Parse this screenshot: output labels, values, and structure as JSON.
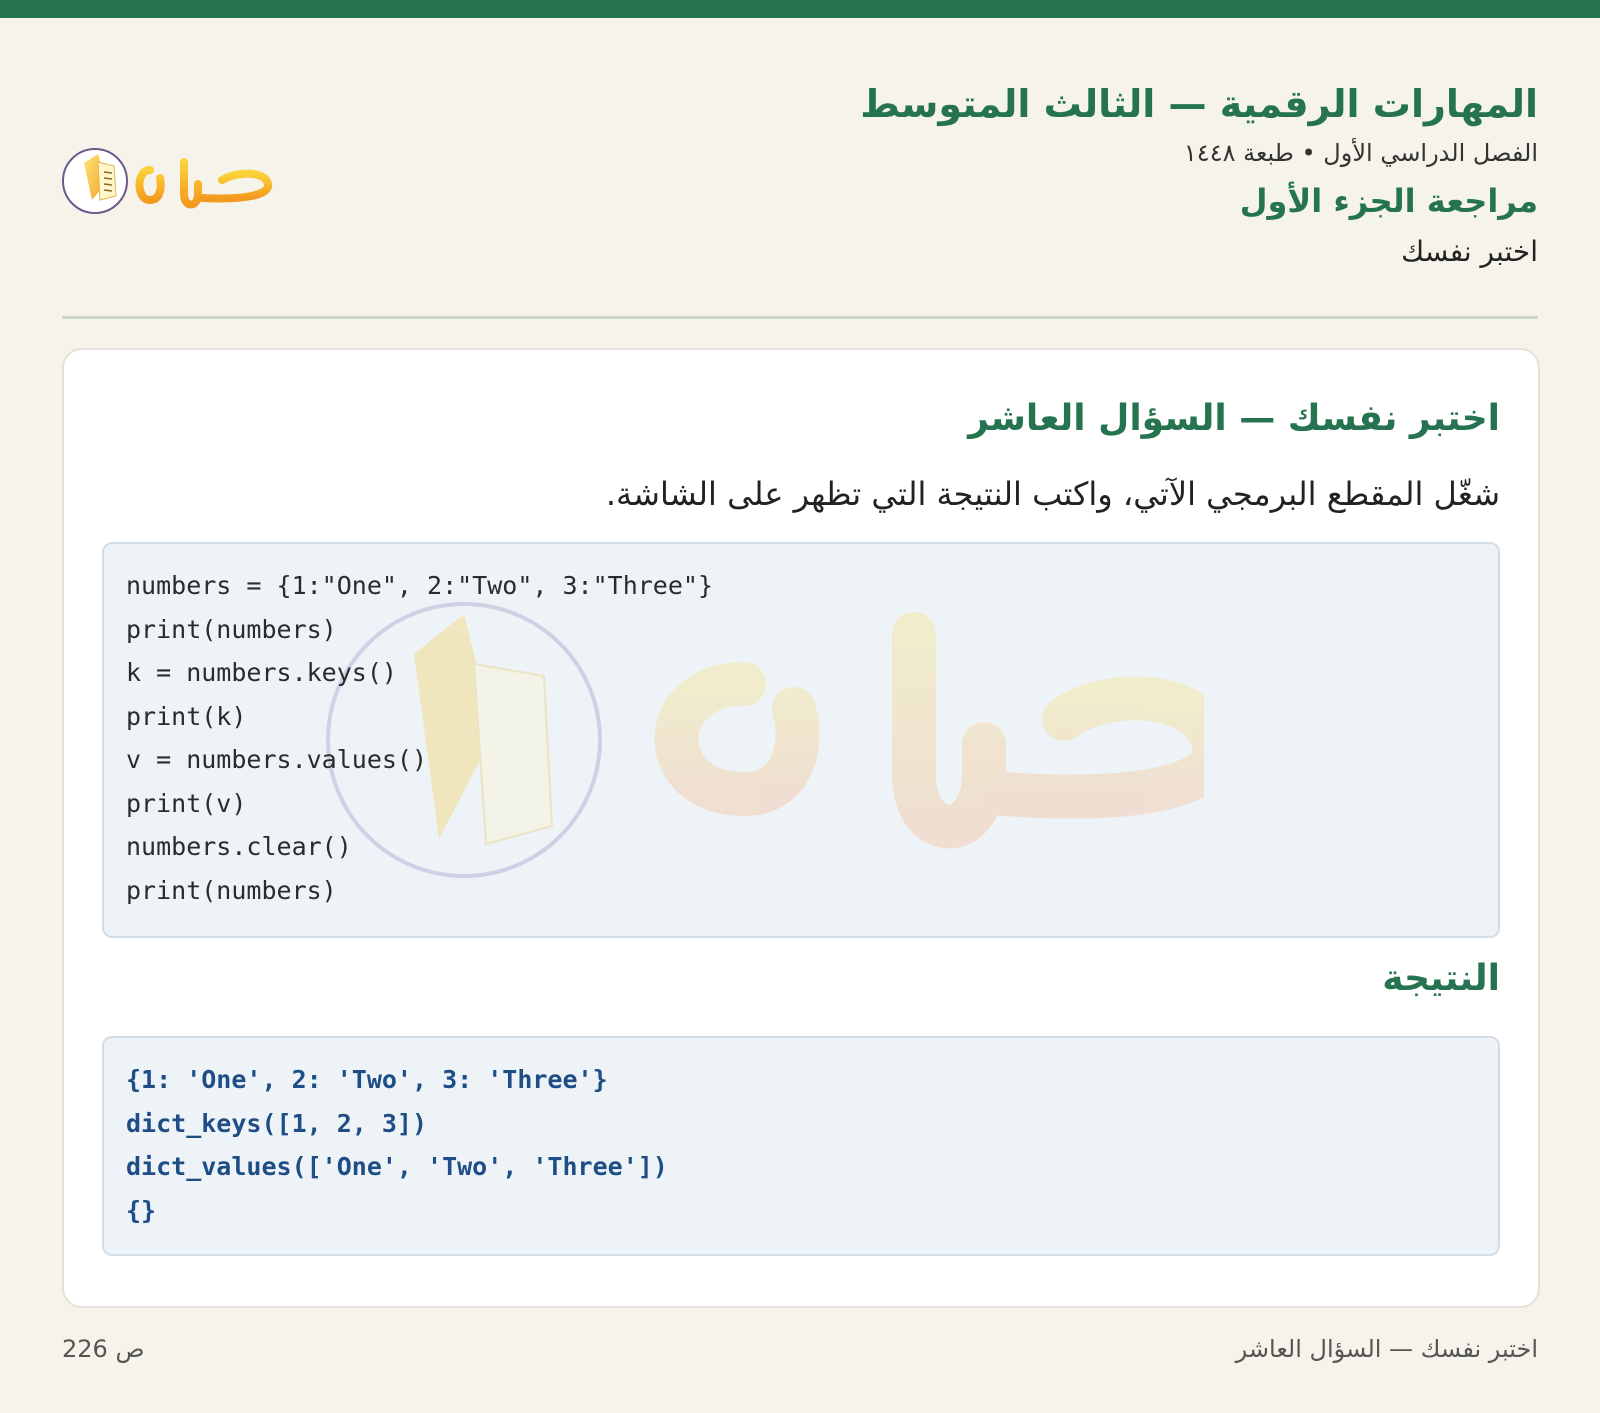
{
  "header": {
    "book_title": "المهارات الرقمية — الثالث المتوسط",
    "meta": "الفصل الدراسي الأول • طبعة ١٤٤٨",
    "unit_title": "مراجعة الجزء الأول",
    "section_title": "اختبر نفسك"
  },
  "logo": {
    "text": "حلول",
    "icon": "book-icon"
  },
  "question": {
    "title": "اختبر نفسك — السؤال العاشر",
    "text": "شغّل المقطع البرمجي الآتي، واكتب النتيجة التي تظهر على الشاشة.",
    "code": [
      "numbers = {1:\"One\", 2:\"Two\", 3:\"Three\"}",
      "print(numbers)",
      "k = numbers.keys()",
      "print(k)",
      "v = numbers.values()",
      "print(v)",
      "numbers.clear()",
      "print(numbers)"
    ]
  },
  "result": {
    "title": "النتيجة",
    "lines": [
      "{1: 'One', 2: 'Two', 3: 'Three'}",
      "dict_keys([1, 2, 3])",
      "dict_values(['One', 'Two', 'Three'])",
      "{}"
    ]
  },
  "footer": {
    "left": "ص 226",
    "right": "اختبر نفسك — السؤال العاشر"
  },
  "colors": {
    "accent": "#25744f",
    "background": "#f6f3ea",
    "code_bg": "#eef3f8",
    "result_text": "#1f4e86"
  }
}
